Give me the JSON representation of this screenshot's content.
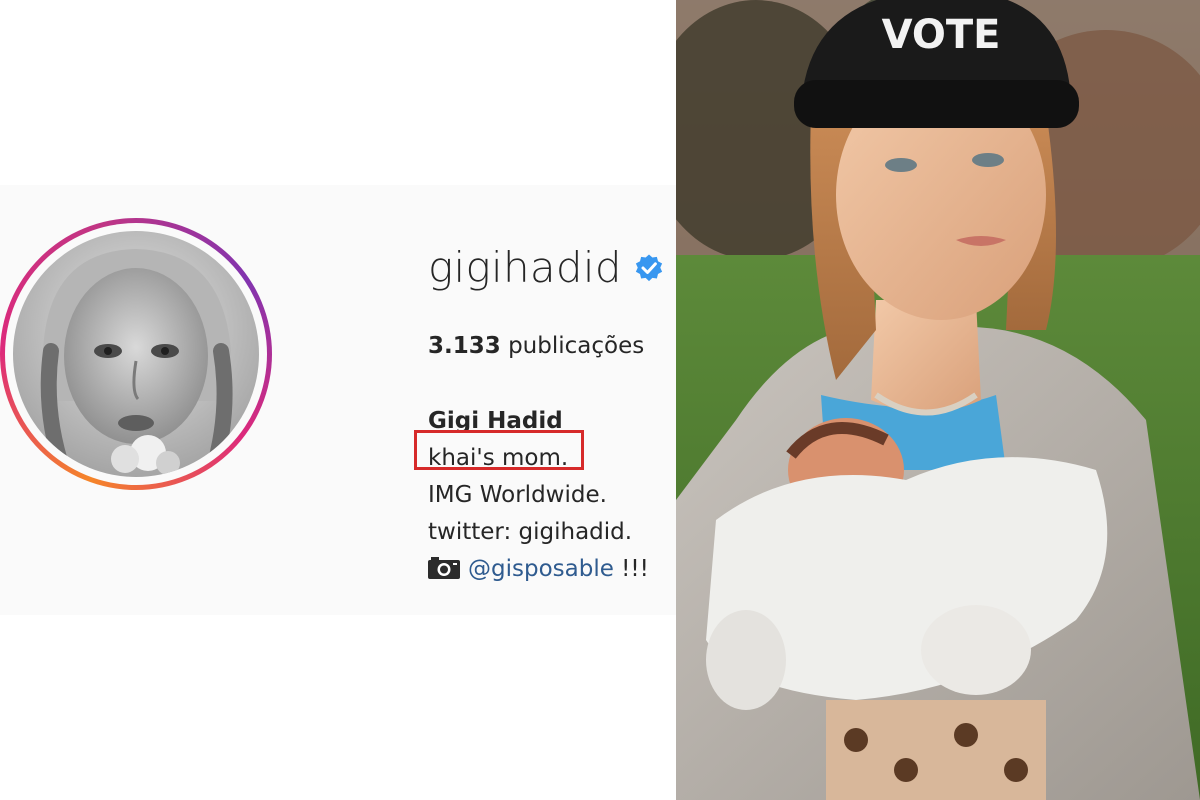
{
  "profile": {
    "username": "gigihadid",
    "verified_icon": "verified-badge-icon",
    "posts_count": "3.133",
    "posts_label": "publicações",
    "full_name": "Gigi Hadid",
    "bio_lines": [
      "khai's mom.",
      "IMG Worldwide.",
      "twitter: gigihadid."
    ],
    "link_icon": "camera-icon",
    "mention": "@gisposable",
    "mention_suffix": " !!!"
  },
  "colors": {
    "highlight_box": "#d62a2a",
    "verified_blue": "#3897f0",
    "mention_blue": "#2f5b8f",
    "ring_gradient": [
      "#f58529",
      "#dd2a7b",
      "#8134af"
    ]
  },
  "photo": {
    "hat_text": "VOTE"
  }
}
